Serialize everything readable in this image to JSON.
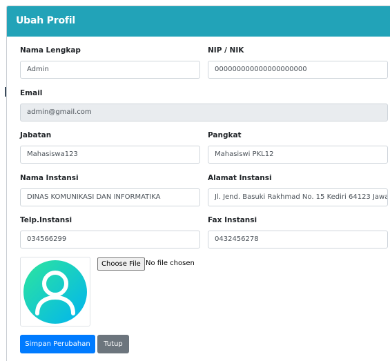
{
  "modal": {
    "title": "Ubah Profil"
  },
  "form": {
    "nama_lengkap": {
      "label": "Nama Lengkap",
      "value": "Admin"
    },
    "nip_nik": {
      "label": "NIP / NIK",
      "value": "000000000000000000000"
    },
    "email": {
      "label": "Email",
      "value": "admin@gmail.com"
    },
    "jabatan": {
      "label": "Jabatan",
      "value": "Mahasiswa123"
    },
    "pangkat": {
      "label": "Pangkat",
      "value": "Mahasiswi PKL12"
    },
    "nama_instansi": {
      "label": "Nama Instansi",
      "value": "DINAS KOMUNIKASI DAN INFORMATIKA"
    },
    "alamat_instansi": {
      "label": "Alamat Instansi",
      "value": "Jl. Jend. Basuki Rakhmad No. 15 Kediri 64123 Jawa"
    },
    "telp_instansi": {
      "label": "Telp.Instansi",
      "value": "034566299"
    },
    "fax_instansi": {
      "label": "Fax Instansi",
      "value": "0432456278"
    }
  },
  "photo": {
    "icon": "user-avatar-icon",
    "file_button_label": "Choose File",
    "file_status": "No file chosen"
  },
  "buttons": {
    "save_label": "Simpan Perubahan",
    "close_label": "Tutup"
  },
  "colors": {
    "header": "#22a3b8",
    "primary": "#007bff",
    "secondary": "#6c757d",
    "avatar_gradient_start": "#2ee59d",
    "avatar_gradient_end": "#00b4f0"
  }
}
